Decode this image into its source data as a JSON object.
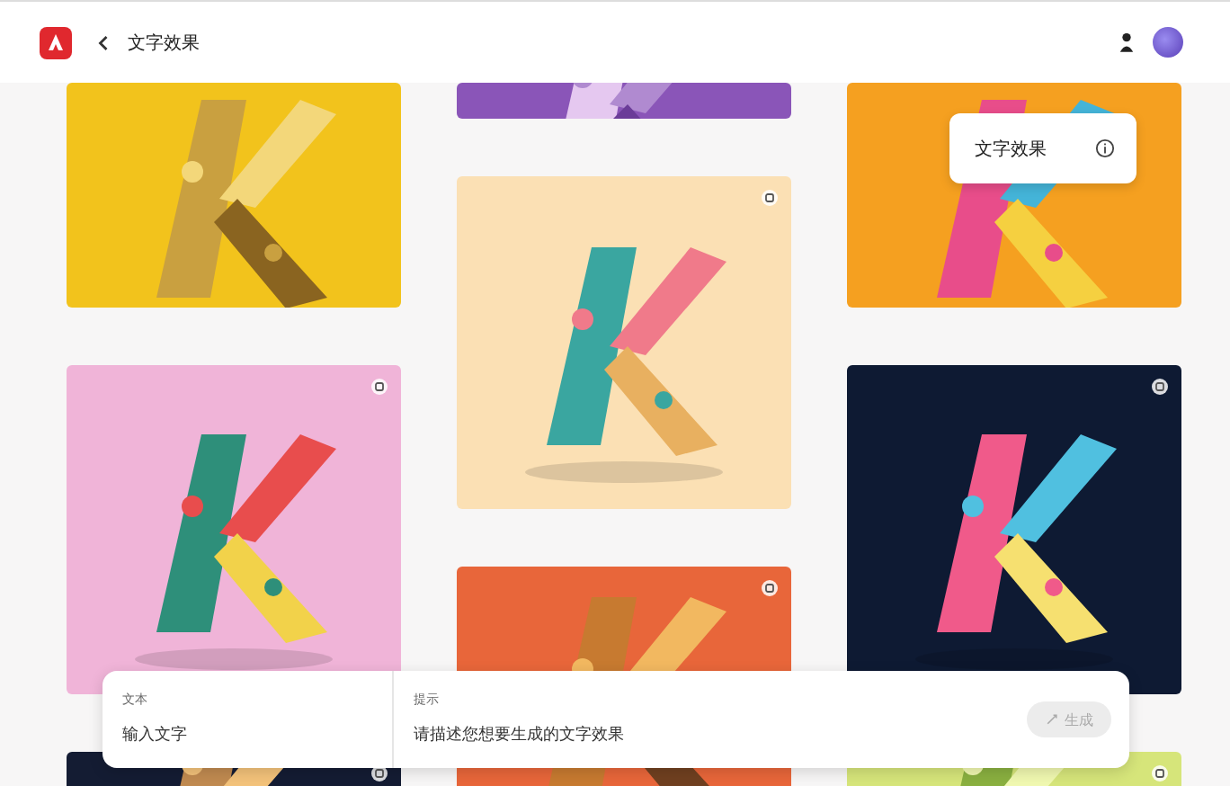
{
  "header": {
    "title": "文字效果"
  },
  "columns": [
    [
      {
        "color": "#f2c31c",
        "icon": false
      },
      {
        "color": "#f0b4d8",
        "icon": true
      },
      {
        "color": "#141c33",
        "icon": true
      }
    ],
    [
      {
        "color": "#8a55b8",
        "icon": false
      },
      {
        "color": "#fbe0b4",
        "icon": true
      },
      {
        "color": "#e8663a",
        "icon": true
      }
    ],
    [
      {
        "color": "#f5a020",
        "icon": false
      },
      {
        "color": "#0e1a33",
        "icon": true
      },
      {
        "color": "#d6e57a",
        "icon": true
      }
    ]
  ],
  "tooltip": {
    "label": "文字效果"
  },
  "prompt_bar": {
    "text_label": "文本",
    "text_placeholder": "输入文字",
    "prompt_label": "提示",
    "prompt_placeholder": "请描述您想要生成的文字效果",
    "button": "生成",
    "button_disabled": true
  }
}
